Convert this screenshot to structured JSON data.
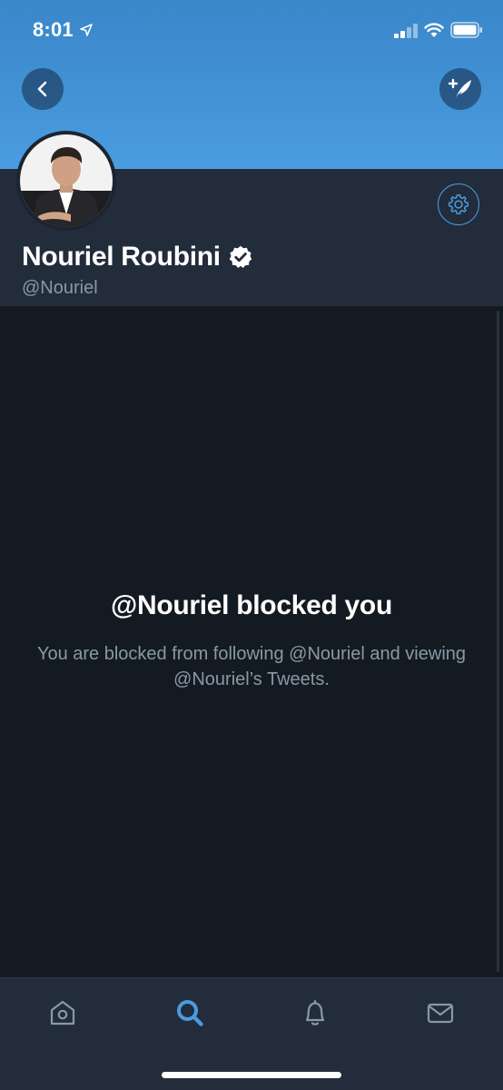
{
  "status_bar": {
    "time": "8:01",
    "icons": [
      "location-arrow-icon",
      "signal-icon",
      "wifi-icon",
      "battery-icon"
    ]
  },
  "header": {
    "back_icon": "chevron-left-icon",
    "compose_icon": "compose-tweet-icon",
    "banner_color": "#4a9ce0"
  },
  "profile": {
    "display_name": "Nouriel Roubini",
    "handle": "@Nouriel",
    "verified": true,
    "settings_icon": "gear-icon"
  },
  "blocked": {
    "title": "@Nouriel blocked you",
    "message": "You are blocked from following @Nouriel and viewing @Nouriel’s Tweets."
  },
  "tabbar": {
    "tabs": [
      {
        "id": "home",
        "icon": "home-icon",
        "active": false
      },
      {
        "id": "search",
        "icon": "search-icon",
        "active": true
      },
      {
        "id": "notifications",
        "icon": "bell-icon",
        "active": false
      },
      {
        "id": "messages",
        "icon": "envelope-icon",
        "active": false
      }
    ],
    "active_color": "#4a9ce0",
    "inactive_color": "#8899a6"
  }
}
